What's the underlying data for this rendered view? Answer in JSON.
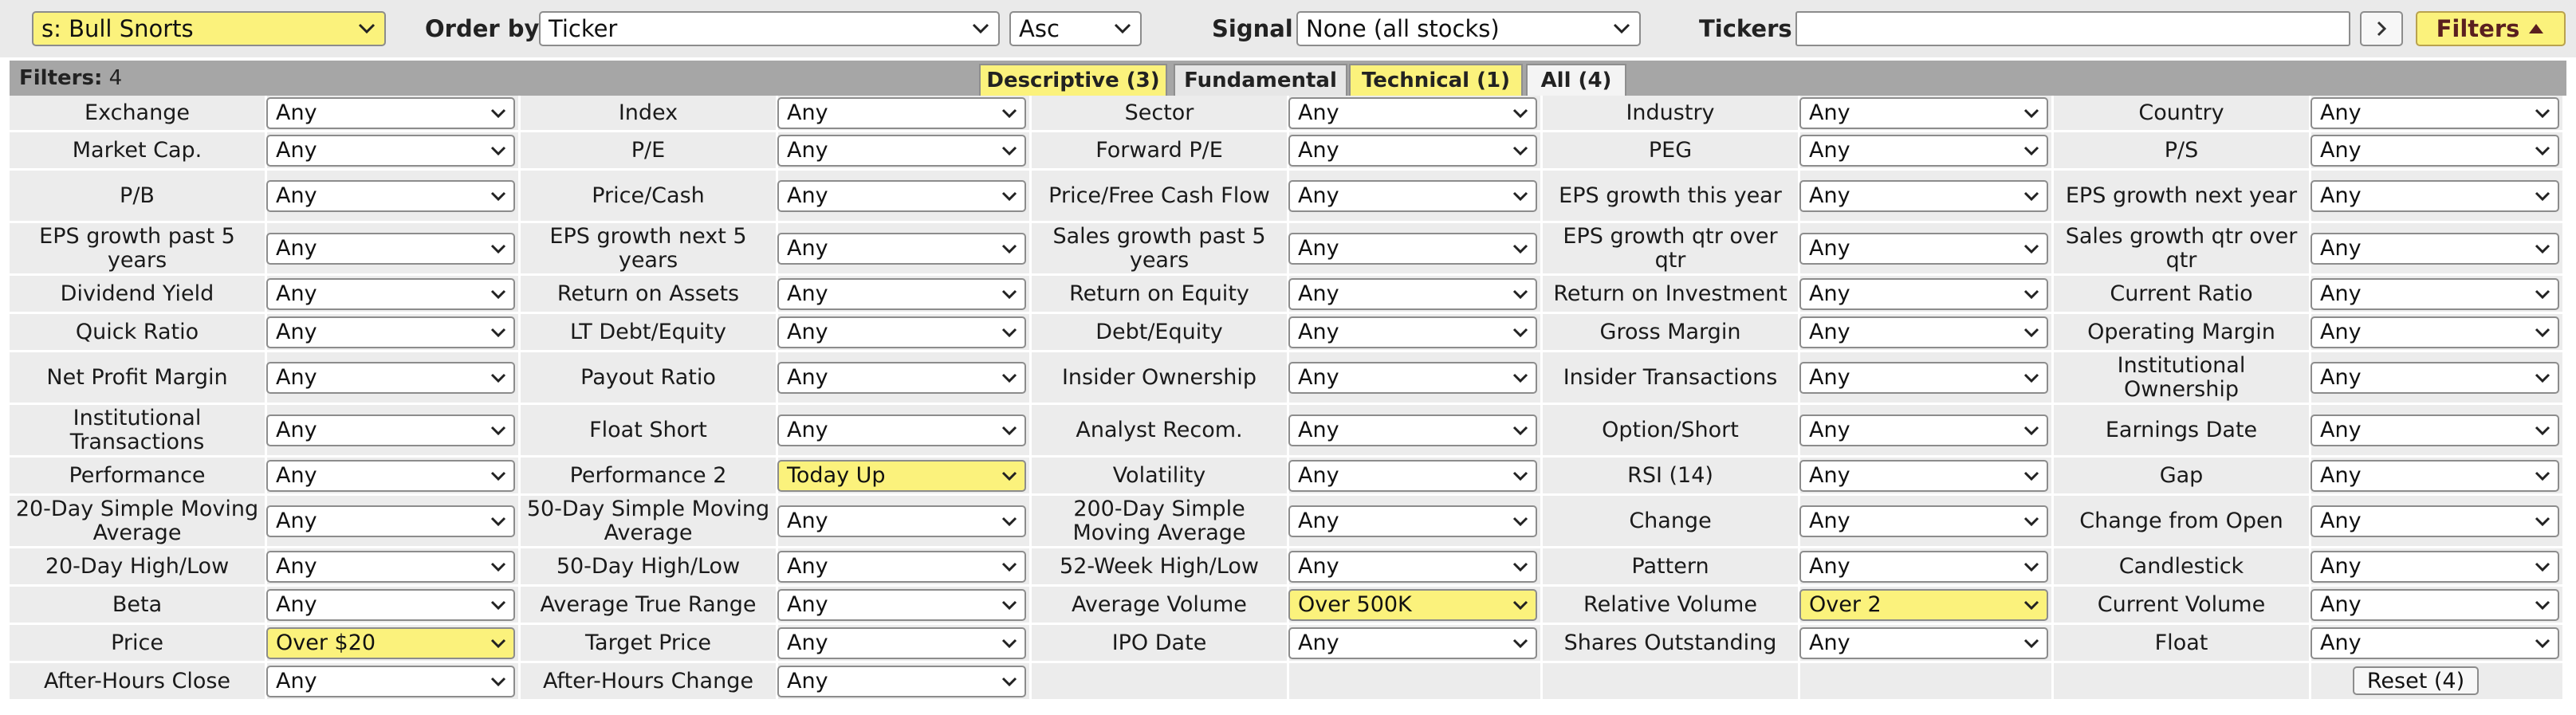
{
  "colors": {
    "highlight": "#fbf27c",
    "header_strip": "#a6a6a6",
    "cell_bg": "#ececec",
    "topbar_bg": "#eaeaea"
  },
  "topbar": {
    "preset_value": "s: Bull Snorts",
    "order_by_label": "Order by",
    "order_by_value": "Ticker",
    "order_dir_value": "Asc",
    "signal_label": "Signal",
    "signal_value": "None (all stocks)",
    "tickers_label": "Tickers",
    "tickers_value": "",
    "go_icon": "chevron-right-icon",
    "filters_label": "Filters",
    "filters_icon": "triangle-up-icon"
  },
  "filters_header": {
    "count_label": "Filters:",
    "count_value": "4",
    "tabs": [
      {
        "label": "Descriptive (3)",
        "state": "highlighted"
      },
      {
        "label": "Fundamental",
        "state": "normal"
      },
      {
        "label": "Technical (1)",
        "state": "highlighted"
      },
      {
        "label": "All (4)",
        "state": "active"
      }
    ]
  },
  "grid": {
    "reset_label": "Reset (4)",
    "rows": [
      [
        {
          "label": "Exchange",
          "value": "Any"
        },
        {
          "label": "Index",
          "value": "Any"
        },
        {
          "label": "Sector",
          "value": "Any"
        },
        {
          "label": "Industry",
          "value": "Any"
        },
        {
          "label": "Country",
          "value": "Any"
        }
      ],
      [
        {
          "label": "Market Cap.",
          "value": "Any"
        },
        {
          "label": "P/E",
          "value": "Any"
        },
        {
          "label": "Forward P/E",
          "value": "Any"
        },
        {
          "label": "PEG",
          "value": "Any"
        },
        {
          "label": "P/S",
          "value": "Any"
        }
      ],
      [
        {
          "label": "P/B",
          "value": "Any"
        },
        {
          "label": "Price/Cash",
          "value": "Any"
        },
        {
          "label": "Price/Free Cash Flow",
          "value": "Any"
        },
        {
          "label": "EPS growth this year",
          "value": "Any"
        },
        {
          "label": "EPS growth next year",
          "value": "Any"
        }
      ],
      [
        {
          "label": "EPS growth past 5 years",
          "value": "Any"
        },
        {
          "label": "EPS growth next 5 years",
          "value": "Any"
        },
        {
          "label": "Sales growth past 5 years",
          "value": "Any"
        },
        {
          "label": "EPS growth qtr over qtr",
          "value": "Any"
        },
        {
          "label": "Sales growth qtr over qtr",
          "value": "Any"
        }
      ],
      [
        {
          "label": "Dividend Yield",
          "value": "Any"
        },
        {
          "label": "Return on Assets",
          "value": "Any"
        },
        {
          "label": "Return on Equity",
          "value": "Any"
        },
        {
          "label": "Return on Investment",
          "value": "Any"
        },
        {
          "label": "Current Ratio",
          "value": "Any"
        }
      ],
      [
        {
          "label": "Quick Ratio",
          "value": "Any"
        },
        {
          "label": "LT Debt/Equity",
          "value": "Any"
        },
        {
          "label": "Debt/Equity",
          "value": "Any"
        },
        {
          "label": "Gross Margin",
          "value": "Any"
        },
        {
          "label": "Operating Margin",
          "value": "Any"
        }
      ],
      [
        {
          "label": "Net Profit Margin",
          "value": "Any"
        },
        {
          "label": "Payout Ratio",
          "value": "Any"
        },
        {
          "label": "Insider Ownership",
          "value": "Any"
        },
        {
          "label": "Insider Transactions",
          "value": "Any"
        },
        {
          "label": "Institutional Ownership",
          "value": "Any"
        }
      ],
      [
        {
          "label": "Institutional Transactions",
          "value": "Any"
        },
        {
          "label": "Float Short",
          "value": "Any"
        },
        {
          "label": "Analyst Recom.",
          "value": "Any"
        },
        {
          "label": "Option/Short",
          "value": "Any"
        },
        {
          "label": "Earnings Date",
          "value": "Any"
        }
      ],
      [
        {
          "label": "Performance",
          "value": "Any"
        },
        {
          "label": "Performance 2",
          "value": "Today Up",
          "active": true
        },
        {
          "label": "Volatility",
          "value": "Any"
        },
        {
          "label": "RSI (14)",
          "value": "Any"
        },
        {
          "label": "Gap",
          "value": "Any"
        }
      ],
      [
        {
          "label": "20-Day Simple Moving Average",
          "value": "Any"
        },
        {
          "label": "50-Day Simple Moving Average",
          "value": "Any"
        },
        {
          "label": "200-Day Simple Moving Average",
          "value": "Any"
        },
        {
          "label": "Change",
          "value": "Any"
        },
        {
          "label": "Change from Open",
          "value": "Any"
        }
      ],
      [
        {
          "label": "20-Day High/Low",
          "value": "Any"
        },
        {
          "label": "50-Day High/Low",
          "value": "Any"
        },
        {
          "label": "52-Week High/Low",
          "value": "Any"
        },
        {
          "label": "Pattern",
          "value": "Any"
        },
        {
          "label": "Candlestick",
          "value": "Any"
        }
      ],
      [
        {
          "label": "Beta",
          "value": "Any"
        },
        {
          "label": "Average True Range",
          "value": "Any"
        },
        {
          "label": "Average Volume",
          "value": "Over 500K",
          "active": true
        },
        {
          "label": "Relative Volume",
          "value": "Over 2",
          "active": true
        },
        {
          "label": "Current Volume",
          "value": "Any"
        }
      ],
      [
        {
          "label": "Price",
          "value": "Over $20",
          "active": true
        },
        {
          "label": "Target Price",
          "value": "Any"
        },
        {
          "label": "IPO Date",
          "value": "Any"
        },
        {
          "label": "Shares Outstanding",
          "value": "Any"
        },
        {
          "label": "Float",
          "value": "Any"
        }
      ],
      [
        {
          "label": "After-Hours Close",
          "value": "Any"
        },
        {
          "label": "After-Hours Change",
          "value": "Any"
        }
      ]
    ]
  }
}
